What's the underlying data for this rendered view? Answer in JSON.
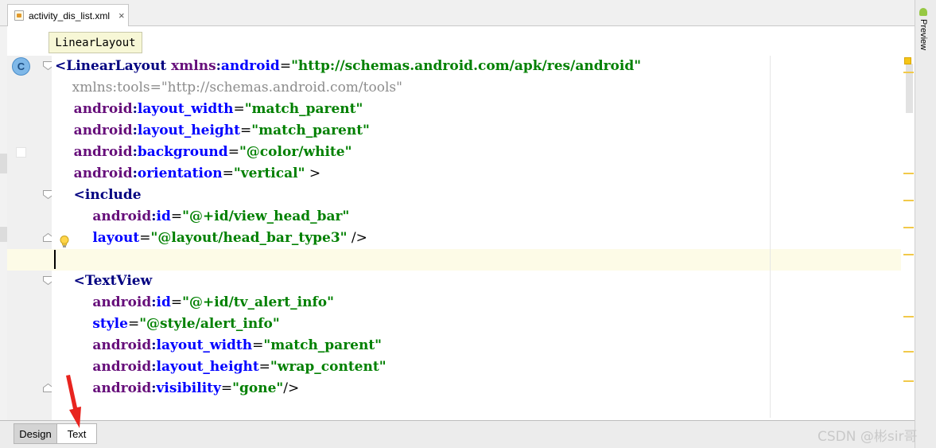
{
  "editor": {
    "tab": {
      "filename": "activity_dis_list.xml",
      "close_glyph": "×"
    },
    "breadcrumb": "LinearLayout",
    "lines": [
      [
        {
          "t": "<LinearLayout ",
          "c": "tag"
        },
        {
          "t": "xmlns",
          "c": "ns"
        },
        {
          "t": ":",
          "c": "tag"
        },
        {
          "t": "android",
          "c": "attr"
        },
        {
          "t": "=",
          "c": "plain"
        },
        {
          "t": "\"http://schemas.android.com/apk/res/android\"",
          "c": "val"
        }
      ],
      [
        {
          "t": "    xmlns:tools=\"http://schemas.android.com/tools\"",
          "c": "dim"
        }
      ],
      [
        {
          "t": "    android",
          "c": "ns"
        },
        {
          "t": ":",
          "c": "tag"
        },
        {
          "t": "layout_width",
          "c": "attr"
        },
        {
          "t": "=",
          "c": "plain"
        },
        {
          "t": "\"match_parent\"",
          "c": "val"
        }
      ],
      [
        {
          "t": "    android",
          "c": "ns"
        },
        {
          "t": ":",
          "c": "tag"
        },
        {
          "t": "layout_height",
          "c": "attr"
        },
        {
          "t": "=",
          "c": "plain"
        },
        {
          "t": "\"match_parent\"",
          "c": "val"
        }
      ],
      [
        {
          "t": "    android",
          "c": "ns"
        },
        {
          "t": ":",
          "c": "tag"
        },
        {
          "t": "background",
          "c": "attr"
        },
        {
          "t": "=",
          "c": "plain"
        },
        {
          "t": "\"@color/white\"",
          "c": "val"
        }
      ],
      [
        {
          "t": "    android",
          "c": "ns"
        },
        {
          "t": ":",
          "c": "tag"
        },
        {
          "t": "orientation",
          "c": "attr"
        },
        {
          "t": "=",
          "c": "plain"
        },
        {
          "t": "\"vertical\"",
          "c": "val"
        },
        {
          "t": " >",
          "c": "plain"
        }
      ],
      [
        {
          "t": "    <include",
          "c": "tag"
        }
      ],
      [
        {
          "t": "        android",
          "c": "ns"
        },
        {
          "t": ":",
          "c": "tag"
        },
        {
          "t": "id",
          "c": "attr"
        },
        {
          "t": "=",
          "c": "plain"
        },
        {
          "t": "\"@+id/view_head_bar\"",
          "c": "val"
        }
      ],
      [
        {
          "t": "        layout",
          "c": "attr"
        },
        {
          "t": "=",
          "c": "plain"
        },
        {
          "t": "\"@layout/head_bar_type3\"",
          "c": "val"
        },
        {
          "t": " />",
          "c": "plain"
        }
      ],
      [],
      [
        {
          "t": "    <TextView",
          "c": "tag"
        }
      ],
      [
        {
          "t": "        android",
          "c": "ns"
        },
        {
          "t": ":",
          "c": "tag"
        },
        {
          "t": "id",
          "c": "attr"
        },
        {
          "t": "=",
          "c": "plain"
        },
        {
          "t": "\"@+id/tv_alert_info\"",
          "c": "val"
        }
      ],
      [
        {
          "t": "        style",
          "c": "attr"
        },
        {
          "t": "=",
          "c": "plain"
        },
        {
          "t": "\"@style/alert_info\"",
          "c": "val"
        }
      ],
      [
        {
          "t": "        android",
          "c": "ns"
        },
        {
          "t": ":",
          "c": "tag"
        },
        {
          "t": "layout_width",
          "c": "attr"
        },
        {
          "t": "=",
          "c": "plain"
        },
        {
          "t": "\"match_parent\"",
          "c": "val"
        }
      ],
      [
        {
          "t": "        android",
          "c": "ns"
        },
        {
          "t": ":",
          "c": "tag"
        },
        {
          "t": "layout_height",
          "c": "attr"
        },
        {
          "t": "=",
          "c": "plain"
        },
        {
          "t": "\"wrap_content\"",
          "c": "val"
        }
      ],
      [
        {
          "t": "        android",
          "c": "ns"
        },
        {
          "t": ":",
          "c": "tag"
        },
        {
          "t": "visibility",
          "c": "attr"
        },
        {
          "t": "=",
          "c": "plain"
        },
        {
          "t": "\"gone\"",
          "c": "val"
        },
        {
          "t": "/>",
          "c": "plain"
        }
      ]
    ],
    "gutter_class_icon": "C",
    "icons": {
      "file": "xml-file-icon",
      "class": "class-icon",
      "fold": "fold-marker-icon",
      "intention": "lightbulb-icon",
      "preview": "android-icon"
    }
  },
  "right_toolbar": {
    "preview_label": "Preview"
  },
  "bottom_tabs": {
    "design": "Design",
    "text": "Text",
    "active": "Text"
  },
  "watermark": "CSDN @彬sir哥",
  "colors": {
    "tag": "#000080",
    "namespace": "#660e7a",
    "attribute": "#0000ff",
    "value": "#008000",
    "current_line": "#fdfbe7",
    "annotation_arrow": "#e8241f"
  }
}
